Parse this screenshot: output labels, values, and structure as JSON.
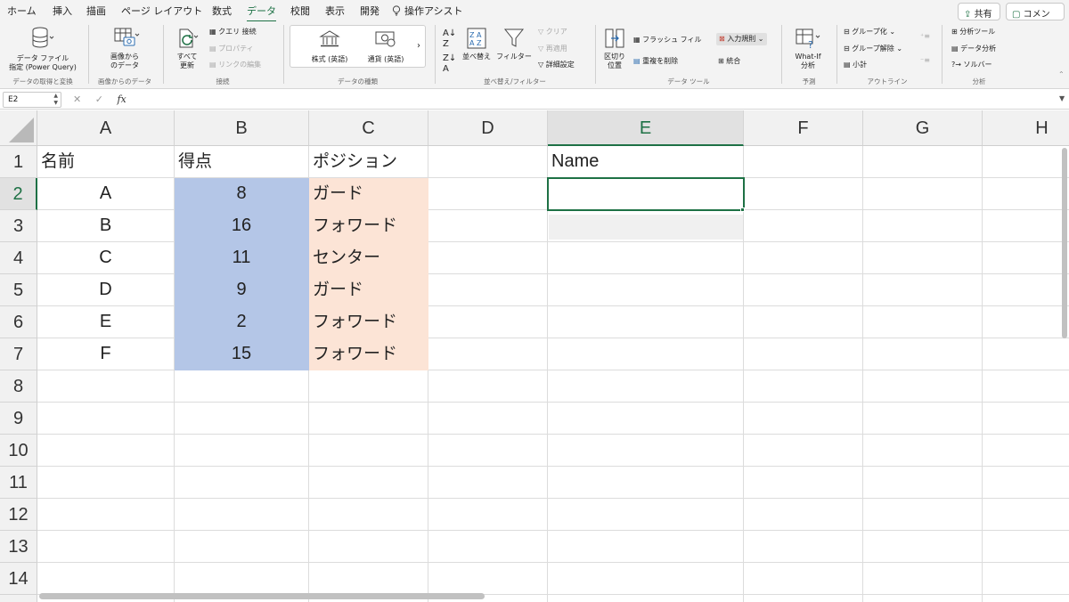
{
  "tabs": [
    "ホーム",
    "挿入",
    "描画",
    "ページ レイアウト",
    "数式",
    "データ",
    "校閲",
    "表示",
    "開発"
  ],
  "active_tab": "データ",
  "assist": "操作アシスト",
  "share_label": "共有",
  "comment_label": "コメント",
  "ribbon": {
    "get_data_l1": "データ ファイル",
    "get_data_l2": "指定 (Power Query)",
    "from_image_l1": "画像から",
    "from_image_l2": "のデータ",
    "refresh_l1": "すべて",
    "refresh_l2": "更新",
    "queries": "クエリ 接続",
    "properties": "プロパティ",
    "edit_links": "リンクの編集",
    "stocks": "株式 (英語)",
    "currency": "通貨 (英語)",
    "sort": "並べ替え",
    "filter": "フィルター",
    "clear": "クリア",
    "reapply": "再適用",
    "advanced": "詳細設定",
    "text_to_cols_l1": "区切り",
    "text_to_cols_l2": "位置",
    "flash_fill": "フラッシュ フィル",
    "remove_dup": "重複を削除",
    "validation": "入力規則",
    "consolidate": "統合",
    "whatif_l1": "What-If",
    "whatif_l2": "分析",
    "group": "グループ化",
    "ungroup": "グループ解除",
    "subtotal": "小計",
    "analysis_tools": "分析ツール",
    "data_analysis": "データ分析",
    "solver": "ソルバー",
    "groups": {
      "get_transform": "データの取得と変換",
      "image_data": "画像からのデータ",
      "connections": "接続",
      "data_types": "データの種類",
      "sort_filter": "並べ替え/フィルター",
      "data_tools": "データ ツール",
      "forecast": "予測",
      "outline": "アウトライン",
      "analysis": "分析"
    }
  },
  "formula_bar": {
    "name_box": "E2",
    "fx": "fx",
    "value": ""
  },
  "columns": [
    "A",
    "B",
    "C",
    "D",
    "E",
    "F",
    "G",
    "H"
  ],
  "selected_column": "E",
  "rows": [
    "1",
    "2",
    "3",
    "4",
    "5",
    "6",
    "7",
    "8",
    "9",
    "10",
    "11",
    "12",
    "13",
    "14"
  ],
  "selected_row": "2",
  "table": {
    "headers": {
      "name": "名前",
      "score": "得点",
      "position": "ポジション"
    },
    "rows": [
      {
        "name": "A",
        "score": "8",
        "position": "ガード"
      },
      {
        "name": "B",
        "score": "16",
        "position": "フォワード"
      },
      {
        "name": "C",
        "score": "11",
        "position": "センター"
      },
      {
        "name": "D",
        "score": "9",
        "position": "ガード"
      },
      {
        "name": "E",
        "score": "2",
        "position": "フォワード"
      },
      {
        "name": "F",
        "score": "15",
        "position": "フォワード"
      }
    ]
  },
  "lookup": {
    "header": "Name",
    "value": ""
  },
  "colors": {
    "accent": "#1e7145",
    "score_fill": "#b4c6e7",
    "position_fill": "#fce4d6"
  }
}
